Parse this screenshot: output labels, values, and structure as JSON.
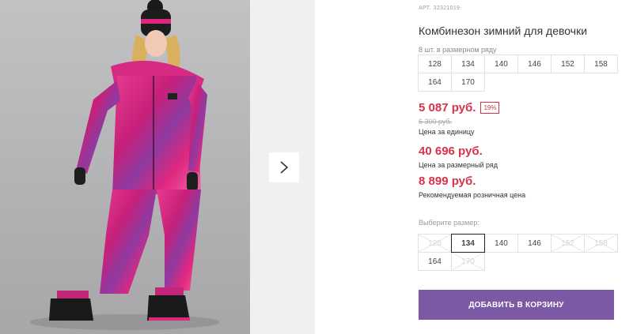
{
  "product": {
    "art_label": "АРТ.",
    "art_number": "32321019",
    "title": "Комбинезон зимний для девочки",
    "pack_note": "8 шт. в размерном ряду"
  },
  "size_row": [
    {
      "label": "128"
    },
    {
      "label": "134"
    },
    {
      "label": "140"
    },
    {
      "label": "146"
    },
    {
      "label": "152"
    },
    {
      "label": "158"
    },
    {
      "label": "164"
    },
    {
      "label": "170"
    }
  ],
  "pricing": {
    "unit_price": "5 087 руб.",
    "discount": "19%",
    "old_price": "6 300 руб.",
    "unit_note": "Цена за единицу",
    "row_price": "40 696 руб.",
    "row_note": "Цена за размерный ряд",
    "rrp_price": "8 899 руб.",
    "rrp_note": "Рекомендуемая розничная цена"
  },
  "size_select": {
    "label": "Выберите размер:",
    "options": [
      {
        "label": "128",
        "state": "disabled"
      },
      {
        "label": "134",
        "state": "selected"
      },
      {
        "label": "140",
        "state": "available"
      },
      {
        "label": "146",
        "state": "available"
      },
      {
        "label": "152",
        "state": "disabled"
      },
      {
        "label": "158",
        "state": "disabled"
      },
      {
        "label": "164",
        "state": "available"
      },
      {
        "label": "170",
        "state": "disabled"
      }
    ]
  },
  "cart_button": {
    "label": "ДОБАВИТЬ В КОРЗИНУ"
  },
  "gallery": {
    "next_icon": "chevron-right-icon"
  },
  "colors": {
    "price": "#d8334a",
    "button": "#7c59a4",
    "suit_pink": "#e0277f"
  }
}
